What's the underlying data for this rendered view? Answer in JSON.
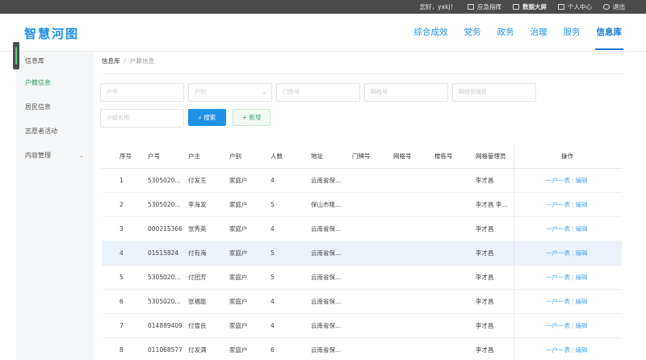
{
  "topbar": {
    "greeting": "您好，yxkj！",
    "items": [
      "应急指挥",
      "数据大屏",
      "个人中心",
      "退出"
    ]
  },
  "header": {
    "logo": "智慧河图",
    "nav": [
      "综合成效",
      "党务",
      "政务",
      "治理",
      "服务",
      "信息库"
    ],
    "active": "信息库"
  },
  "sidebar": {
    "items": [
      {
        "label": "信息库"
      },
      {
        "label": "户籍信息"
      },
      {
        "label": "居民信息"
      },
      {
        "label": "志愿者活动"
      },
      {
        "label": "内容管理",
        "chevron": "⌄"
      }
    ],
    "active": "户籍信息"
  },
  "breadcrumb": {
    "root": "信息库",
    "current": "户籍信息"
  },
  "filters": {
    "hukou_no": "户号",
    "hukou_type": "户别",
    "door_no": "门牌号",
    "grid_no": "网格号",
    "grid_manager": "网格管理员",
    "group_name": "小组名称"
  },
  "buttons": {
    "search": "搜索",
    "add": "新增"
  },
  "table": {
    "headers": [
      "序号",
      "户号",
      "户主",
      "户别",
      "人数",
      "地址",
      "门牌号",
      "网格号",
      "楼栋号",
      "网格管理员",
      "操作"
    ],
    "rows": [
      {
        "no": "1",
        "hukou": "5305020...",
        "holder": "付发玉",
        "type": "家庭户",
        "count": "4",
        "address": "云南省保...",
        "door": "",
        "grid": "",
        "building": "",
        "manager": "李才昌"
      },
      {
        "no": "2",
        "hukou": "5305020...",
        "holder": "李海发",
        "type": "家庭户",
        "count": "5",
        "address": "保山市隆...",
        "door": "",
        "grid": "",
        "building": "",
        "manager": "李才昌 李..."
      },
      {
        "no": "3",
        "hukou": "000215366",
        "holder": "张秀英",
        "type": "家庭户",
        "count": "4",
        "address": "云南省保...",
        "door": "",
        "grid": "",
        "building": "",
        "manager": "李才昌"
      },
      {
        "no": "4",
        "hukou": "01515824",
        "holder": "付有海",
        "type": "家庭户",
        "count": "5",
        "address": "云南省保...",
        "door": "",
        "grid": "",
        "building": "",
        "manager": "李才昌"
      },
      {
        "no": "5",
        "hukou": "5305020...",
        "holder": "付团芳",
        "type": "家庭户",
        "count": "5",
        "address": "云南省保...",
        "door": "",
        "grid": "",
        "building": "",
        "manager": "李才昌"
      },
      {
        "no": "6",
        "hukou": "5305020...",
        "holder": "张福能",
        "type": "家庭户",
        "count": "4",
        "address": "云南省保...",
        "door": "",
        "grid": "",
        "building": "",
        "manager": "李才昌"
      },
      {
        "no": "7",
        "hukou": "014889409",
        "holder": "付雪良",
        "type": "家庭户",
        "count": "4",
        "address": "云南省保...",
        "door": "",
        "grid": "",
        "building": "",
        "manager": "李才昌"
      },
      {
        "no": "8",
        "hukou": "011068577",
        "holder": "付发满",
        "type": "家庭户",
        "count": "6",
        "address": "云南省保...",
        "door": "",
        "grid": "",
        "building": "",
        "manager": "李才昌"
      }
    ],
    "highlighted_row": 4,
    "row_actions": {
      "view": "一户一表",
      "edit": "编辑"
    }
  },
  "colors": {
    "accent": "#1e90e6",
    "active_green": "#3aa26b",
    "topbar": "#4b4b4b"
  }
}
